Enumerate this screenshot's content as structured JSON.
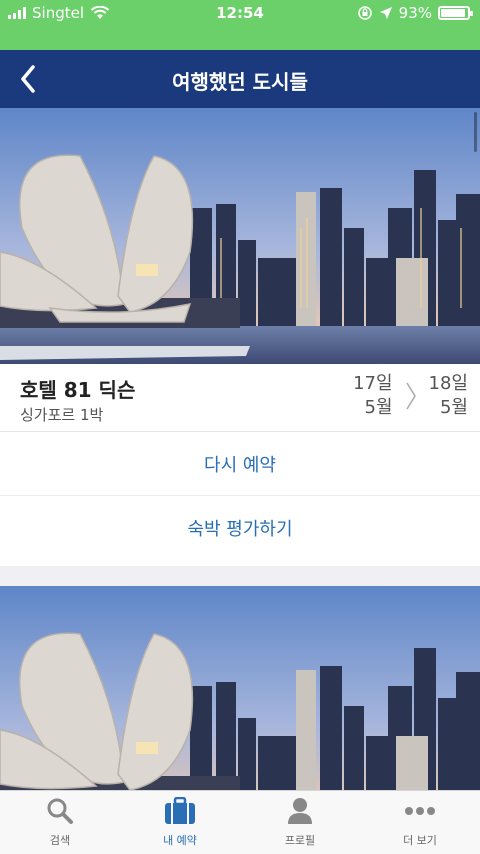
{
  "status_bar": {
    "carrier": "Singtel",
    "time": "12:54",
    "battery": "93%",
    "battery_level": 0.93
  },
  "header": {
    "title": "여행했던 도시들"
  },
  "booking": {
    "hotel_name": "호텔 81 딕슨",
    "subtitle": "싱가포르 1박",
    "checkin_day": "17일",
    "checkin_month": "5월",
    "checkout_day": "18일",
    "checkout_month": "5월",
    "actions": {
      "rebook": "다시 예약",
      "review": "숙박 평가하기"
    }
  },
  "tabbar": {
    "tabs": [
      {
        "label": "검색",
        "icon": "search-icon"
      },
      {
        "label": "내 예약",
        "icon": "suitcase-icon",
        "active": true
      },
      {
        "label": "프로필",
        "icon": "person-icon"
      },
      {
        "label": "더 보기",
        "icon": "more-dots-icon"
      }
    ]
  },
  "colors": {
    "status_bar": "#6bd06a",
    "header": "#1b3a7e",
    "accent": "#2a6fb5"
  }
}
